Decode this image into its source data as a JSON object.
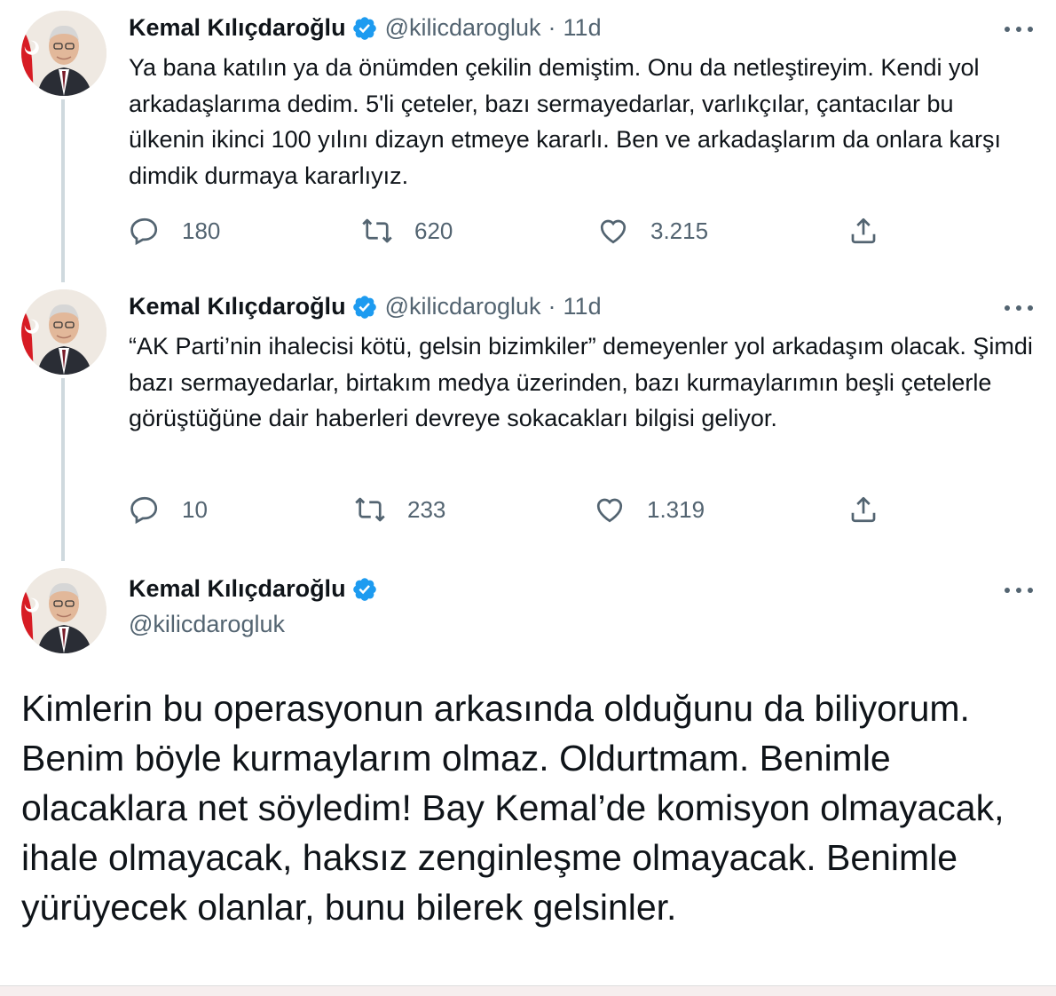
{
  "colors": {
    "text": "#0f1419",
    "muted": "#536471",
    "verified": "#1d9bf0",
    "thread_line": "#cfd9de"
  },
  "tweets": [
    {
      "author": {
        "name": "Kemal Kılıçdaroğlu",
        "handle": "@kilicdarogluk",
        "verified": true,
        "avatar_icon": "avatar-photo"
      },
      "separator": "·",
      "time": "11d",
      "text": "Ya bana katılın ya da önümden çekilin demiştim. Onu da netleştireyim. Kendi yol arkadaşlarıma dedim. 5'li çeteler, bazı sermayedarlar, varlıkçılar, çantacılar bu ülkenin ikinci 100 yılını dizayn etmeye kararlı. Ben ve arkadaşlarım da onlara karşı dimdik durmaya kararlıyız.",
      "stats": {
        "replies": "180",
        "retweets": "620",
        "likes": "3.215"
      }
    },
    {
      "author": {
        "name": "Kemal Kılıçdaroğlu",
        "handle": "@kilicdarogluk",
        "verified": true,
        "avatar_icon": "avatar-photo"
      },
      "separator": "·",
      "time": "11d",
      "text": "“AK Parti’nin ihalecisi kötü, gelsin bizimkiler” demeyenler yol arkadaşım olacak. Şimdi bazı sermayedarlar, birtakım medya üzerinden, bazı kurmaylarımın beşli çetelerle görüştüğüne dair haberleri devreye sokacakları bilgisi geliyor.",
      "stats": {
        "replies": "10",
        "retweets": "233",
        "likes": "1.319"
      }
    }
  ],
  "main_tweet": {
    "author": {
      "name": "Kemal Kılıçdaroğlu",
      "handle": "@kilicdarogluk",
      "verified": true,
      "avatar_icon": "avatar-photo"
    },
    "text": "Kimlerin bu operasyonun arkasında olduğunu da biliyorum. Benim böyle kurmaylarım olmaz. Oldurtmam. Benimle olacaklara net söyledim! Bay Kemal’de komisyon olmayacak, ihale olmayacak, haksız zenginleşme olmayacak. Benimle yürüyecek olanlar, bunu bilerek gelsinler."
  },
  "icons": [
    "reply-icon",
    "retweet-icon",
    "like-icon",
    "share-icon",
    "more-icon",
    "verified-icon"
  ]
}
